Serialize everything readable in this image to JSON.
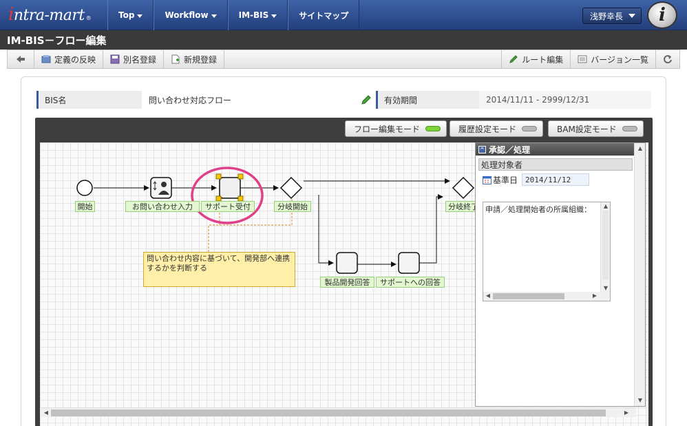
{
  "app": {
    "logo_i": "i",
    "logo_rest": "ntra-mart",
    "logo_reg": "®"
  },
  "nav": {
    "items": [
      {
        "label": "Top",
        "has_caret": true
      },
      {
        "label": "Workflow",
        "has_caret": true
      },
      {
        "label": "IM-BIS",
        "has_caret": true
      },
      {
        "label": "サイトマップ",
        "has_caret": false
      }
    ],
    "user": "浅野幸長",
    "profile_glyph": "i"
  },
  "page_title": "IM-BIS－フロー編集",
  "toolbar": {
    "back_icon": "arrow-left-icon",
    "left": [
      {
        "label": "定義の反映",
        "icon": "deploy-icon"
      },
      {
        "label": "別名登録",
        "icon": "save-as-icon"
      },
      {
        "label": "新規登録",
        "icon": "new-document-icon"
      }
    ],
    "right": [
      {
        "label": "ルート編集",
        "icon": "pencil-icon"
      },
      {
        "label": "バージョン一覧",
        "icon": "list-icon"
      }
    ],
    "refresh_icon": "refresh-icon"
  },
  "info": {
    "bis_name_label": "BIS名",
    "bis_name": "問い合わせ対応フロー",
    "edit_icon": "pencil-icon",
    "period_label": "有効期間",
    "period": "2014/11/11 ‐ 2999/12/31"
  },
  "modes": [
    {
      "label": "フロー編集モード",
      "active": true,
      "led_color": "#7cd43a"
    },
    {
      "label": "履歴設定モード",
      "active": false,
      "led_color": "#b8b8b8"
    },
    {
      "label": "BAM設定モード",
      "active": false,
      "led_color": "#b8b8b8"
    }
  ],
  "flow": {
    "nodes": {
      "start": "開始",
      "inquiry": "お問い合わせ入力",
      "support": "サポート受付",
      "branch_start": "分岐開始",
      "branch_end": "分岐終了",
      "product": "製品開発回答",
      "support_reply": "サポートへの回答"
    },
    "note": "問い合わせ内容に基づいて、開発部へ連携するかを判断する",
    "selected_node": "サポート受付"
  },
  "panel": {
    "title": "承認／処理",
    "collapse_glyph": "^",
    "section": "処理対象者",
    "base_date_label": "基準日",
    "base_date": "2014/11/12",
    "rule_text": "申請／処理開始者の所属組織："
  },
  "colors": {
    "nav_blue": "#2f4f8f",
    "title_bar": "#3a3a3a",
    "node_label_bg": "#e2f7cf",
    "note_bg": "#ffefa8",
    "highlight_ring": "#e0408a",
    "handle": "#f5c800"
  }
}
